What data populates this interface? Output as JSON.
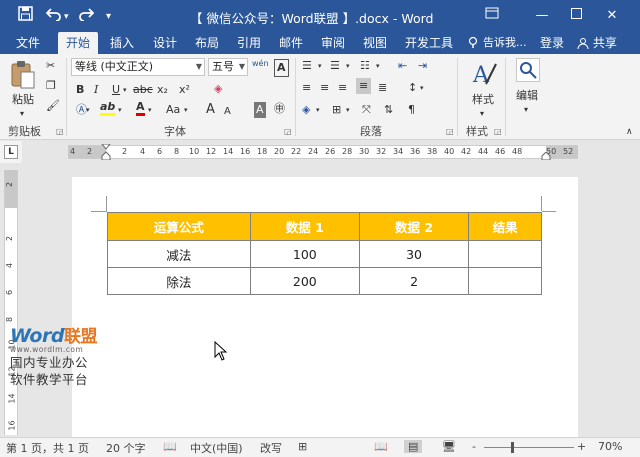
{
  "titlebar": {
    "title": "【 微信公众号：Word联盟 】.docx - Word",
    "save_icon": "save-icon",
    "undo_icon": "undo-icon",
    "redo_icon": "redo-icon",
    "qat_more": "▾"
  },
  "tabs": [
    "文件",
    "开始",
    "插入",
    "设计",
    "布局",
    "引用",
    "邮件",
    "审阅",
    "视图",
    "开发工具"
  ],
  "tell_me": "告诉我...",
  "login": "登录",
  "share": "共享",
  "ribbon": {
    "clipboard": {
      "paste": "粘贴",
      "label": "剪贴板"
    },
    "font": {
      "font_name": "等线 (中文正文)",
      "font_size": "五号",
      "wen": "wén",
      "bold": "B",
      "italic": "I",
      "underline": "U",
      "strike": "abc",
      "sub": "x₂",
      "sup": "x²",
      "grow": "A",
      "shrink": "A",
      "case": "Aa",
      "label": "字体"
    },
    "paragraph": {
      "label": "段落"
    },
    "styles": {
      "button": "样式",
      "label": "样式"
    },
    "editing": {
      "button": "编辑"
    }
  },
  "ruler": {
    "h_numbers": [
      "4",
      "2",
      "2",
      "4",
      "6",
      "8",
      "10",
      "12",
      "14",
      "16",
      "18",
      "20",
      "22",
      "24",
      "26",
      "28",
      "30",
      "32",
      "34",
      "36",
      "38",
      "40",
      "42",
      "44",
      "46",
      "48",
      "50",
      "52"
    ],
    "v_numbers": [
      "2",
      "2",
      "4",
      "6",
      "8",
      "10",
      "12",
      "14",
      "16"
    ],
    "corner": "L"
  },
  "table": {
    "headers": [
      "运算公式",
      "数据 1",
      "数据 2",
      "结果"
    ],
    "rows": [
      [
        "减法",
        "100",
        "30",
        ""
      ],
      [
        "除法",
        "200",
        "2",
        ""
      ]
    ],
    "header_color": "#ffc000"
  },
  "watermark": {
    "logo_en": "Word",
    "logo_cn": "联盟",
    "url": "www.wordlm.com",
    "line1": "国内专业办公",
    "line2": "软件教学平台"
  },
  "status": {
    "page": "第 1 页，共 1 页",
    "words": "20 个字",
    "language": "中文(中国)",
    "mode": "改写",
    "zoom_minus": "-",
    "zoom_plus": "+",
    "zoom": "70%"
  }
}
